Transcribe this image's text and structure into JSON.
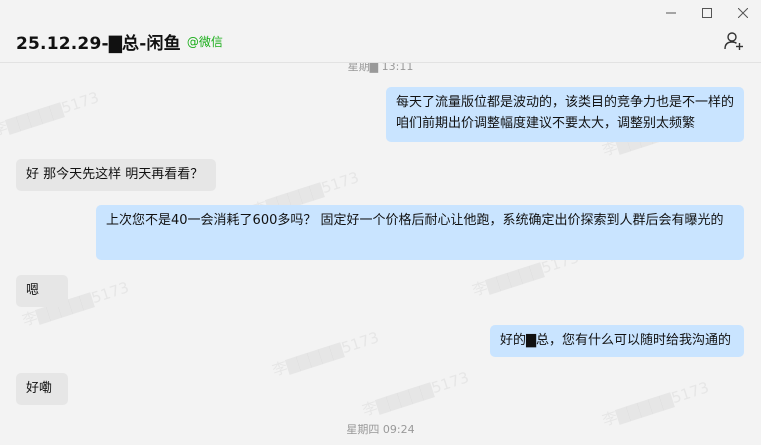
{
  "window": {
    "controls": [
      "minimize",
      "maximize",
      "close"
    ]
  },
  "header": {
    "title": "25.12.29-▇总-闲鱼",
    "source": "@微信"
  },
  "chat": {
    "timestamp_top": "星期▇ 13:11",
    "timestamp_bottom": "星期四 09:24",
    "messages": [
      {
        "side": "out",
        "text": "每天了流量版位都是波动的，该类目的竞争力也是不一样的 咱们前期出价调整幅度建议不要太大，调整别太频繁"
      },
      {
        "side": "in",
        "text": "好  那今天先这样 明天再看看？"
      },
      {
        "side": "out",
        "text": "上次您不是40一会消耗了600多吗？      固定好一个价格后耐心让他跑，系统确定出价探索到人群后会有曝光的"
      },
      {
        "side": "in",
        "text": "嗯"
      },
      {
        "side": "out",
        "text": "好的▇总，您有什么可以随时给我沟通的"
      },
      {
        "side": "in",
        "text": "好嘞"
      }
    ],
    "watermark": "李▇▇▇▇▇5173"
  },
  "colors": {
    "outgoing_bubble": "#c9e4ff",
    "incoming_bubble": "#e6e6e6",
    "source_tag": "#1aad19",
    "background": "#f3f3f3"
  }
}
